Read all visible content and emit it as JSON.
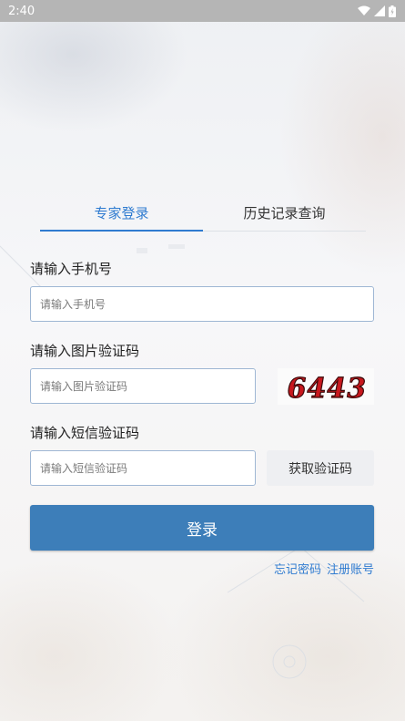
{
  "status_bar": {
    "time": "2:40",
    "icons": [
      "wifi-icon",
      "signal-icon",
      "battery-icon"
    ]
  },
  "tabs": [
    {
      "label": "专家登录",
      "active": true
    },
    {
      "label": "历史记录查询",
      "active": false
    }
  ],
  "form": {
    "phone": {
      "label": "请输入手机号",
      "placeholder": "请输入手机号",
      "value": ""
    },
    "image_code": {
      "label": "请输入图片验证码",
      "placeholder": "请输入图片验证码",
      "value": "",
      "captcha_text": "6443"
    },
    "sms_code": {
      "label": "请输入短信验证码",
      "placeholder": "请输入短信验证码",
      "value": "",
      "button_label": "获取验证码"
    },
    "login_label": "登录"
  },
  "links": {
    "forgot_password": "忘记密码",
    "register": "注册账号"
  },
  "colors": {
    "accent": "#2f7bd0",
    "login_button": "#3d7eb9",
    "input_border": "#9fb7d4",
    "captcha_text": "#c8181e"
  }
}
